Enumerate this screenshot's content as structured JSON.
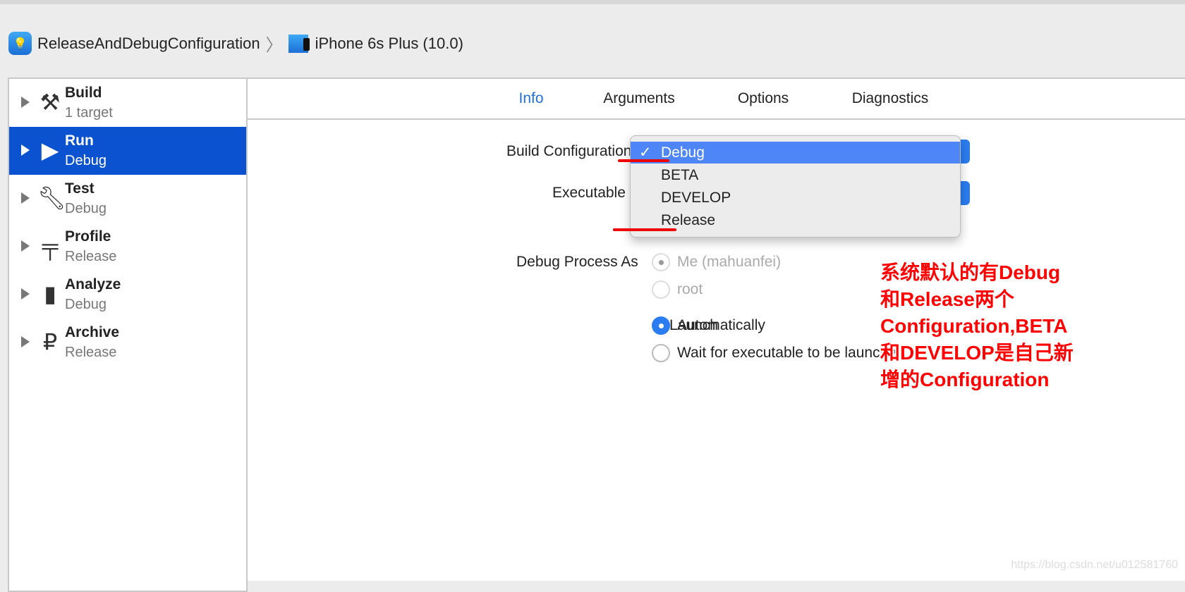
{
  "breadcrumb": {
    "project": "ReleaseAndDebugConfiguration",
    "device": "iPhone 6s Plus (10.0)"
  },
  "sidebar": {
    "items": [
      {
        "title": "Build",
        "subtitle": "1 target",
        "icon": "hammer-icon",
        "selected": false
      },
      {
        "title": "Run",
        "subtitle": "Debug",
        "icon": "play-icon",
        "selected": true
      },
      {
        "title": "Test",
        "subtitle": "Debug",
        "icon": "wrench-icon",
        "selected": false
      },
      {
        "title": "Profile",
        "subtitle": "Release",
        "icon": "instruments-icon",
        "selected": false
      },
      {
        "title": "Analyze",
        "subtitle": "Debug",
        "icon": "analyze-icon",
        "selected": false
      },
      {
        "title": "Archive",
        "subtitle": "Release",
        "icon": "archive-icon",
        "selected": false
      }
    ]
  },
  "tabs": [
    "Info",
    "Arguments",
    "Options",
    "Diagnostics"
  ],
  "active_tab": "Info",
  "form": {
    "build_configuration_label": "Build Configuration",
    "executable_label": "Executable",
    "debug_process_label": "Debug Process As",
    "debug_process_options": [
      "Me (mahuanfei)",
      "root"
    ],
    "launch_label": "Launch",
    "launch_options": [
      "Automatically",
      "Wait for executable to be launched"
    ]
  },
  "dropdown": {
    "selected": "Debug",
    "options": [
      "Debug",
      "BETA",
      "DEVELOP",
      "Release"
    ]
  },
  "annotation": {
    "lines": [
      "系统默认的有Debug",
      "和Release两个",
      "Configuration,BETA",
      "和DEVELOP是自己新",
      "增的Configuration"
    ]
  },
  "watermark": "https://blog.csdn.net/u012581760",
  "colors": {
    "selection": "#0b52d0",
    "menu_highlight": "#4f86f7",
    "annotation": "#ff0000",
    "accent": "#2b7cf0"
  }
}
